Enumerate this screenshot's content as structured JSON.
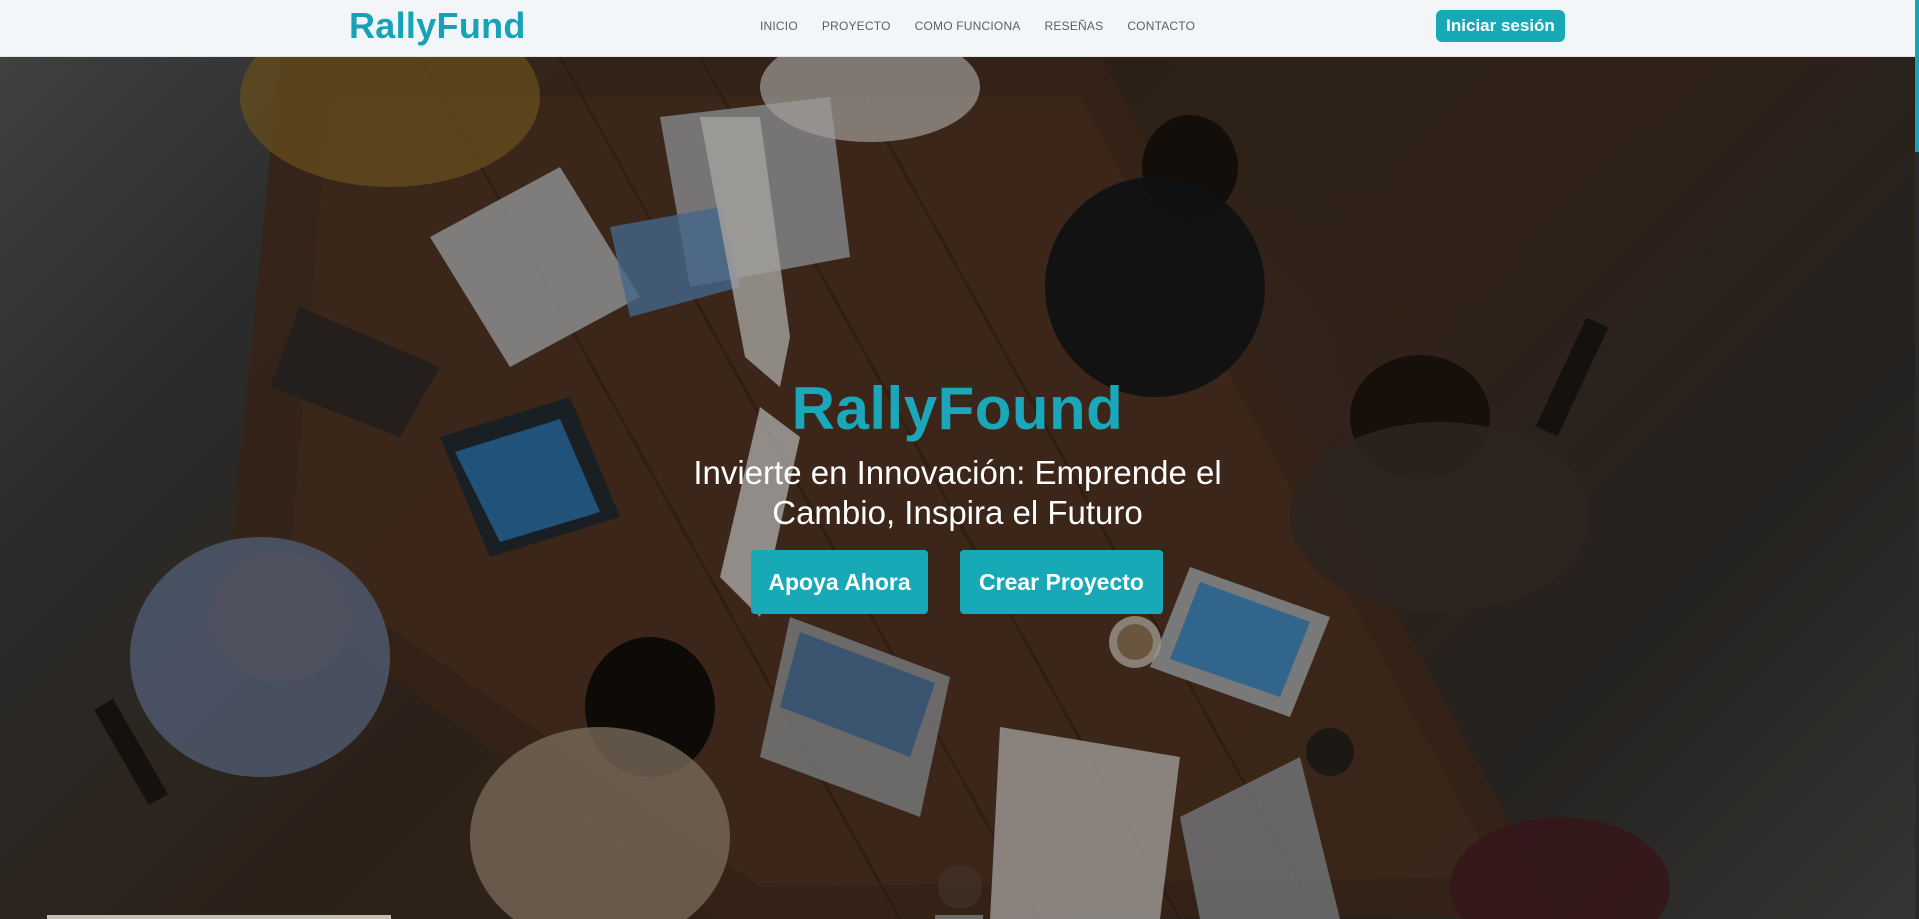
{
  "navbar": {
    "brand": "RallyFund",
    "links": [
      "INICIO",
      "PROYECTO",
      "COMO FUNCIONA",
      "RESEÑAS",
      "CONTACTO"
    ],
    "login_label": "Iniciar sesión"
  },
  "hero": {
    "title": "RallyFound",
    "subtitle": "Invierte en Innovación: Emprende el Cambio, Inspira el Futuro",
    "support_label": "Apoya Ahora",
    "create_label": "Crear Proyecto"
  },
  "colors": {
    "accent": "#17a9b6",
    "nav_background": "#f3f6f8"
  }
}
